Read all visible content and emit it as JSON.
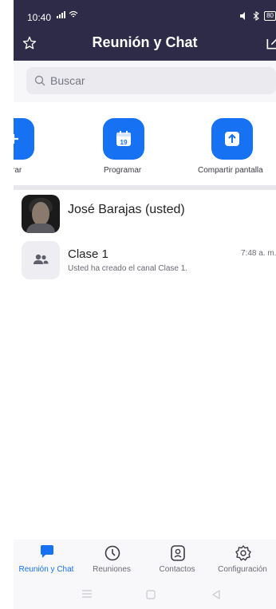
{
  "status_bar": {
    "time": "10:40",
    "battery": "80"
  },
  "header": {
    "title": "Reunión y Chat"
  },
  "search": {
    "placeholder": "Buscar"
  },
  "actions": [
    {
      "label": "Entrar",
      "icon": "plus-icon"
    },
    {
      "label": "Programar",
      "icon": "calendar-icon",
      "day": "19"
    },
    {
      "label": "Compartir pantalla",
      "icon": "share-screen-icon"
    }
  ],
  "contacts": {
    "self": {
      "name": "José Barajas (usted)"
    },
    "channels": [
      {
        "name": "Clase 1",
        "subtitle": "Usted ha creado el canal Clase 1.",
        "time": "7:48 a. m."
      }
    ]
  },
  "tabs": [
    {
      "label": "Reunión y Chat",
      "icon": "chat-icon",
      "active": true
    },
    {
      "label": "Reuniones",
      "icon": "clock-icon",
      "active": false
    },
    {
      "label": "Contactos",
      "icon": "contacts-icon",
      "active": false
    },
    {
      "label": "Configuración",
      "icon": "gear-icon",
      "active": false
    }
  ],
  "colors": {
    "header_bg": "#2d2b47",
    "accent": "#1672f3"
  }
}
